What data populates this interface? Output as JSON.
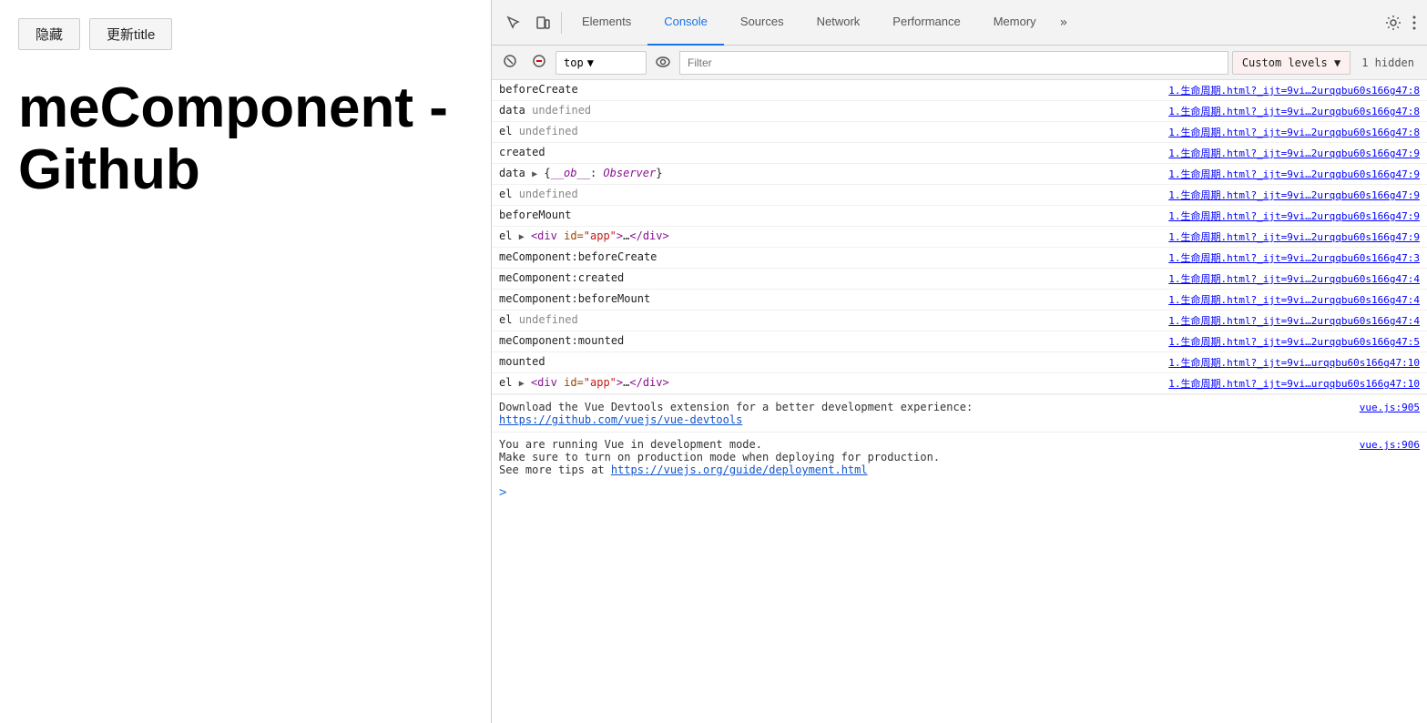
{
  "leftPanel": {
    "hideBtn": "隐藏",
    "updateBtn": "更新title",
    "title": "meComponent - Github"
  },
  "devtools": {
    "tabs": [
      {
        "id": "elements",
        "label": "Elements",
        "active": false
      },
      {
        "id": "console",
        "label": "Console",
        "active": true
      },
      {
        "id": "sources",
        "label": "Sources",
        "active": false
      },
      {
        "id": "network",
        "label": "Network",
        "active": false
      },
      {
        "id": "performance",
        "label": "Performance",
        "active": false
      },
      {
        "id": "memory",
        "label": "Memory",
        "active": false
      }
    ],
    "more": "»",
    "contextSelect": "top",
    "filterPlaceholder": "Filter",
    "levelsLabel": "Custom levels ▼",
    "hiddenCount": "1 hidden",
    "consoleRows": [
      {
        "message": "beforeCreate",
        "source": "1.生命周期.html?_ijt=9vi…2urqqbu60s166g47:8"
      },
      {
        "message": "data <span class='kw-undefined'>undefined</span>",
        "source": "1.生命周期.html?_ijt=9vi…2urqqbu60s166g47:8"
      },
      {
        "message": "el <span class='kw-undefined'>undefined</span>",
        "source": "1.生命周期.html?_ijt=9vi…2urqqbu60s166g47:8"
      },
      {
        "message": "created",
        "source": "1.生命周期.html?_ijt=9vi…2urqqbu60s166g47:9"
      },
      {
        "message": "data <span class='kw-expand'>▶</span> {<span class='kw-keyword'>__ob__</span>: <span class='kw-keyword'>Observer</span>}",
        "source": "1.生命周期.html?_ijt=9vi…2urqqbu60s166g47:9"
      },
      {
        "message": "el <span class='kw-undefined'>undefined</span>",
        "source": "1.生命周期.html?_ijt=9vi…2urqqbu60s166g47:9"
      },
      {
        "message": "beforeMount",
        "source": "1.生命周期.html?_ijt=9vi…2urqqbu60s166g47:9"
      },
      {
        "message": "el <span class='kw-expand'>▶</span> <span class='kw-tag'>&lt;div</span> <span class='kw-attr'>id=</span><span class='kw-string'>\"app\"</span><span class='kw-tag'>&gt;</span>…<span class='kw-tag'>&lt;/div&gt;</span>",
        "source": "1.生命周期.html?_ijt=9vi…2urqqbu60s166g47:9"
      },
      {
        "message": "meComponent:beforeCreate",
        "source": "1.生命周期.html?_ijt=9vi…2urqqbu60s166g47:3"
      },
      {
        "message": "meComponent:created",
        "source": "1.生命周期.html?_ijt=9vi…2urqqbu60s166g47:4"
      },
      {
        "message": "meComponent:beforeMount",
        "source": "1.生命周期.html?_ijt=9vi…2urqqbu60s166g47:4"
      },
      {
        "message": "el <span class='kw-undefined'>undefined</span>",
        "source": "1.生命周期.html?_ijt=9vi…2urqqbu60s166g47:4"
      },
      {
        "message": "meComponent:mounted",
        "source": "1.生命周期.html?_ijt=9vi…2urqqbu60s166g47:5"
      },
      {
        "message": "mounted",
        "source": "1.生命周期.html?_ijt=9vi…urqqbu60s166g47:10"
      },
      {
        "message": "el <span class='kw-expand'>▶</span> <span class='kw-tag'>&lt;div</span> <span class='kw-attr'>id=</span><span class='kw-string'>\"app\"</span><span class='kw-tag'>&gt;</span>…<span class='kw-tag'>&lt;/div&gt;</span>",
        "source": "1.生命周期.html?_ijt=9vi…urqqbu60s166g47:10"
      }
    ],
    "vueDevtoolsMsg": "Download the Vue Devtools extension for a better development experience:",
    "vueDevtoolsLink": "https://github.com/vuejs/vue-devtools",
    "vueDevtoolsSource": "vue.js:905",
    "vueModeMsg1": "You are running Vue in development mode.",
    "vueModeMsg2": "Make sure to turn on production mode when deploying for production.",
    "vueModeMsg3": "See more tips at",
    "vueModeLink": "https://vuejs.org/guide/deployment.html",
    "vueModeSource": "vue.js:906",
    "prompt": ">"
  }
}
